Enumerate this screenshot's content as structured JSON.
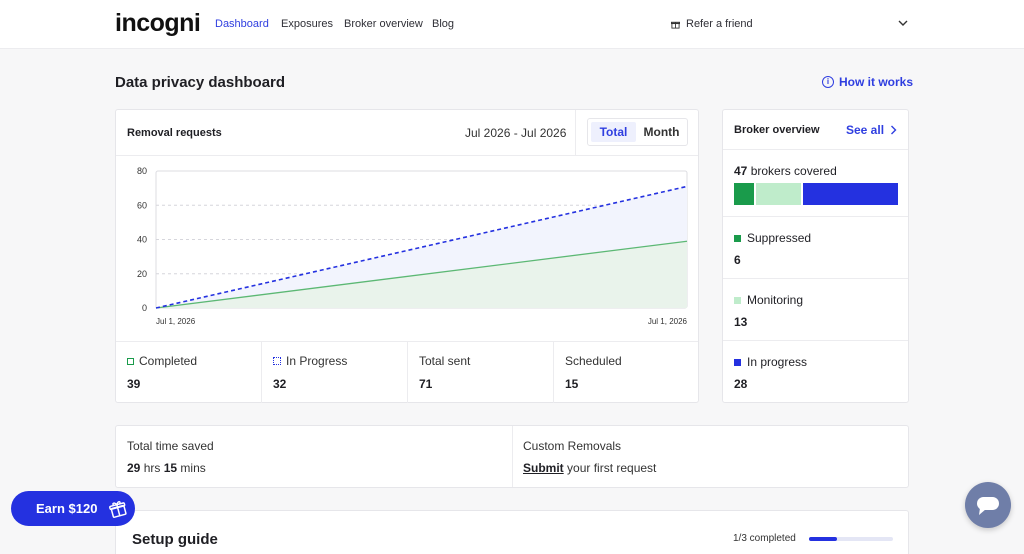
{
  "nav": {
    "logo": "incogni",
    "links": [
      "Dashboard",
      "Exposures",
      "Broker overview",
      "Blog"
    ],
    "refer": "Refer a friend"
  },
  "page": {
    "title": "Data privacy dashboard",
    "how_it_works": "How it works"
  },
  "removal": {
    "title": "Removal requests",
    "range": "Jul 2026 - Jul 2026",
    "toggle": [
      "Total",
      "Month"
    ],
    "stats": [
      {
        "label": "Completed",
        "value": "39"
      },
      {
        "label": "In Progress",
        "value": "32"
      },
      {
        "label": "Total sent",
        "value": "71"
      },
      {
        "label": "Scheduled",
        "value": "15"
      }
    ]
  },
  "chart_data": {
    "type": "area",
    "x": [
      "Jul 1, 2026",
      "Jul 1, 2026"
    ],
    "ylim": [
      0,
      80
    ],
    "yticks": [
      "80",
      "60",
      "40",
      "20",
      "0"
    ],
    "series": [
      {
        "name": "Completed",
        "values": [
          0,
          39
        ],
        "color": "#5cb874"
      },
      {
        "name": "In Progress",
        "values": [
          0,
          71
        ],
        "color": "#2431e0"
      }
    ]
  },
  "broker": {
    "title": "Broker overview",
    "see_all": "See all",
    "covered_num": "47",
    "covered_text": "brokers covered",
    "bar": [
      {
        "value": 6,
        "color": "#1a9b4b"
      },
      {
        "value": 13,
        "color": "#bfeccb"
      },
      {
        "value": 28,
        "color": "#2431e0"
      }
    ],
    "items": [
      {
        "label": "Suppressed",
        "value": "6",
        "color": "#1a9b4b"
      },
      {
        "label": "Monitoring",
        "value": "13",
        "color": "#bfeccb"
      },
      {
        "label": "In progress",
        "value": "28",
        "color": "#2431e0"
      }
    ]
  },
  "time_saved": {
    "label": "Total time saved",
    "hours": "29",
    "hrs": "hrs",
    "minutes": "15",
    "mins": "mins"
  },
  "custom": {
    "label": "Custom Removals",
    "link": "Submit",
    "rest": "your first request"
  },
  "setup": {
    "title": "Setup guide",
    "progress_text": "1/3 completed",
    "progress": 0.33
  },
  "earn": {
    "label": "Earn $120"
  }
}
